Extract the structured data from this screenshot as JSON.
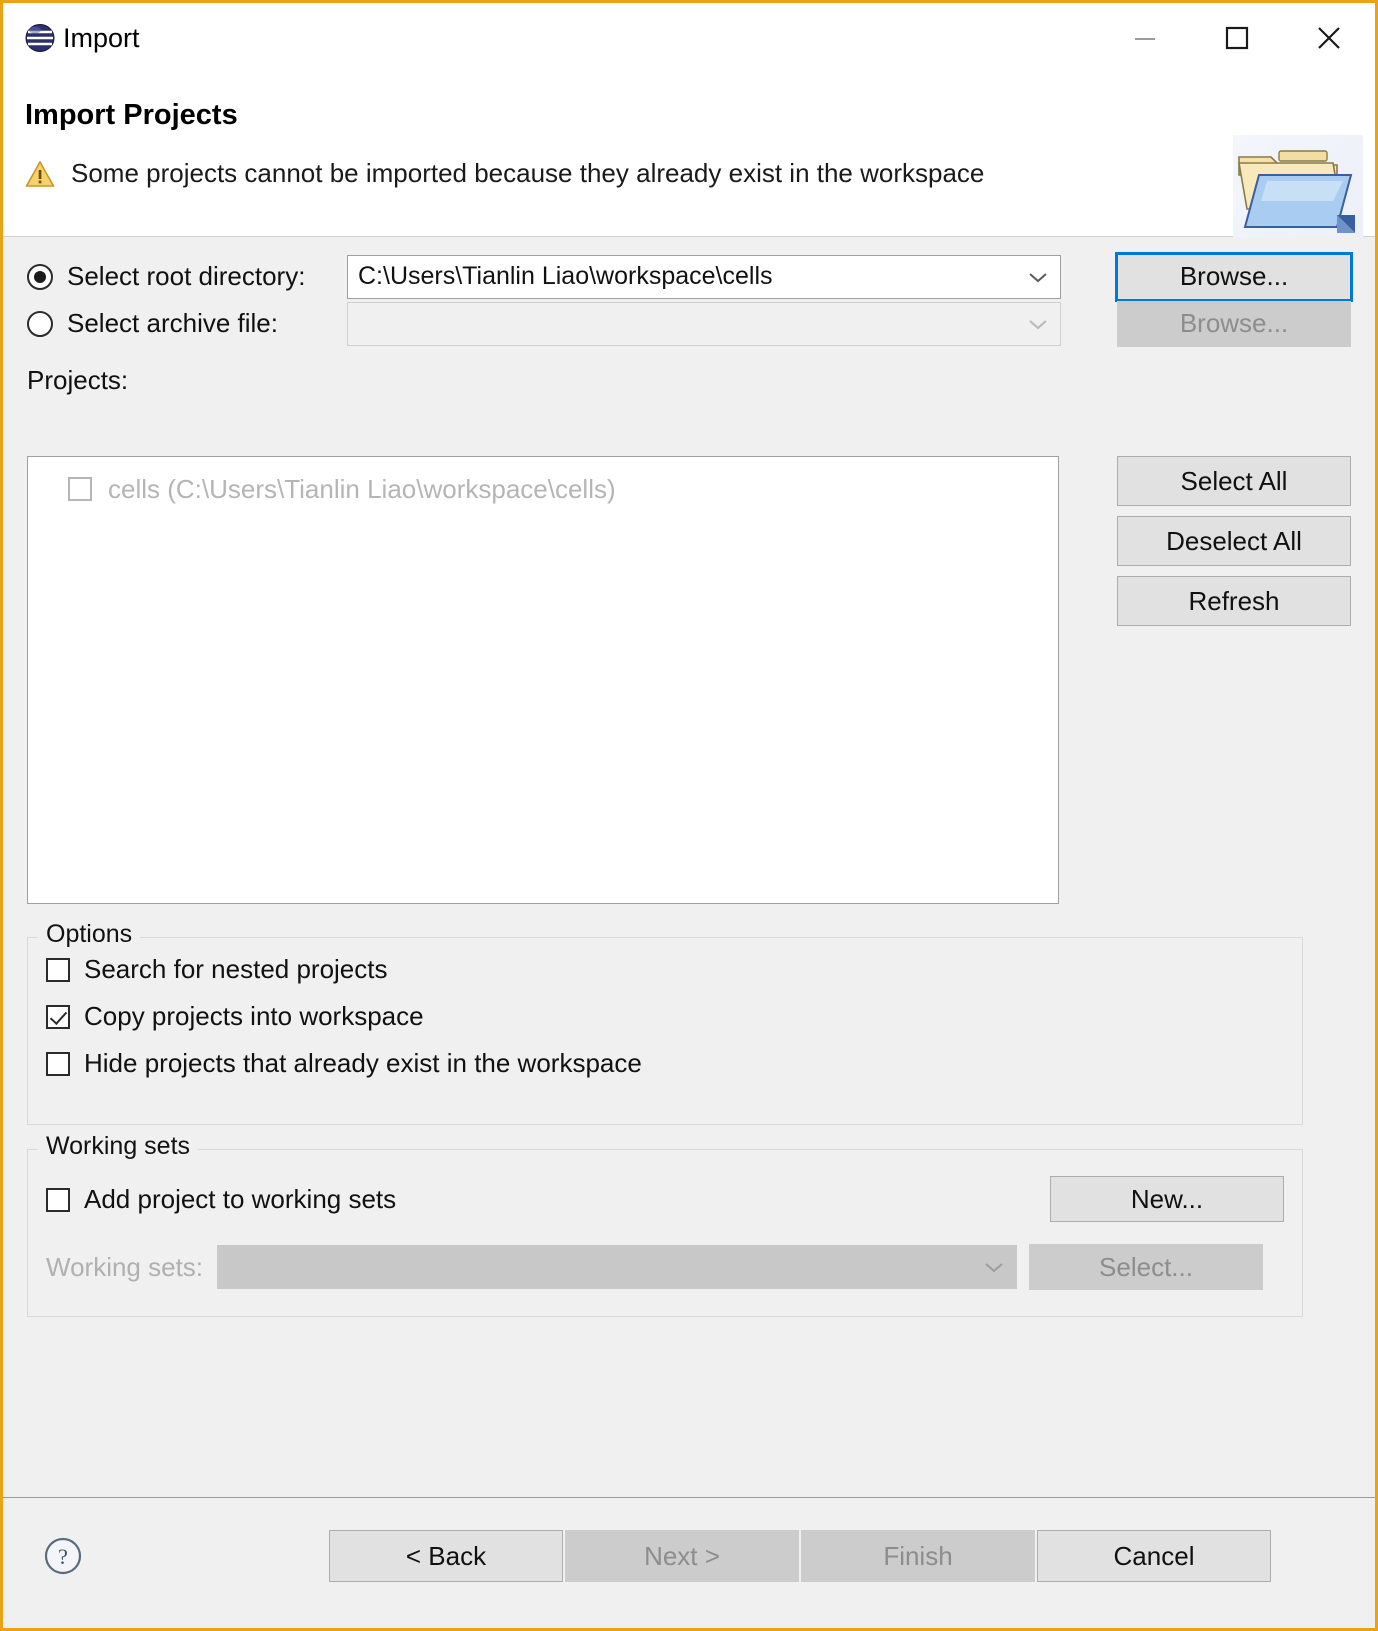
{
  "window": {
    "title": "Import",
    "icon": "eclipse-globe-icon",
    "border_color": "#e8a317",
    "controls": {
      "minimize": "minimize-icon",
      "maximize": "maximize-icon",
      "close": "close-icon"
    }
  },
  "header": {
    "title": "Import Projects",
    "status_icon": "warning-triangle-icon",
    "status_message": "Some projects cannot be imported because they already exist in the workspace",
    "graphic": "open-folder-icon",
    "warning_color": "#e8b22c"
  },
  "source": {
    "root_directory": {
      "label": "Select root directory:",
      "selected": true,
      "value": "C:\\Users\\Tianlin Liao\\workspace\\cells",
      "browse_label": "Browse...",
      "browse_enabled": true,
      "browse_focused": true
    },
    "archive_file": {
      "label": "Select archive file:",
      "selected": false,
      "value": "",
      "browse_label": "Browse...",
      "browse_enabled": false
    }
  },
  "projects": {
    "label": "Projects:",
    "items": [
      {
        "label": "cells (C:\\Users\\Tianlin Liao\\workspace\\cells)",
        "checked": false,
        "enabled": false
      }
    ],
    "buttons": [
      {
        "label": "Select All",
        "enabled": true
      },
      {
        "label": "Deselect All",
        "enabled": true
      },
      {
        "label": "Refresh",
        "enabled": true
      }
    ]
  },
  "options": {
    "title": "Options",
    "checkboxes": [
      {
        "label": "Search for nested projects",
        "checked": false
      },
      {
        "label": "Copy projects into workspace",
        "checked": true
      },
      {
        "label": "Hide projects that already exist in the workspace",
        "checked": false
      }
    ]
  },
  "working_sets": {
    "title": "Working sets",
    "add_checkbox": {
      "label": "Add project to working sets",
      "checked": false
    },
    "new_button": {
      "label": "New...",
      "enabled": true
    },
    "combo_label": "Working sets:",
    "combo_value": "",
    "combo_enabled": false,
    "select_button": {
      "label": "Select...",
      "enabled": false
    }
  },
  "footer": {
    "help_icon": "help-question-icon",
    "buttons": [
      {
        "label": "< Back",
        "enabled": true
      },
      {
        "label": "Next >",
        "enabled": false
      },
      {
        "label": "Finish",
        "enabled": false
      },
      {
        "label": "Cancel",
        "enabled": true
      }
    ]
  }
}
